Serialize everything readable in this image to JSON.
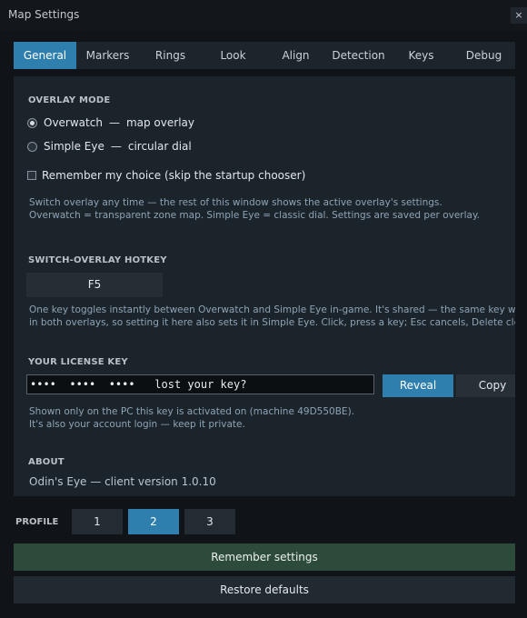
{
  "window": {
    "title": "Map Settings",
    "close_glyph": "×"
  },
  "tabs": [
    {
      "label": "General",
      "active": true
    },
    {
      "label": "Markers",
      "active": false
    },
    {
      "label": "Rings",
      "active": false
    },
    {
      "label": "Look",
      "active": false
    },
    {
      "label": "Align",
      "active": false
    },
    {
      "label": "Detection",
      "active": false
    },
    {
      "label": "Keys",
      "active": false
    },
    {
      "label": "Debug",
      "active": false
    }
  ],
  "overlay_mode": {
    "heading": "OVERLAY MODE",
    "options": [
      {
        "name": "Overwatch",
        "desc": "map overlay",
        "selected": true
      },
      {
        "name": "Simple Eye",
        "desc": "circular dial",
        "selected": false
      }
    ],
    "separator": "—",
    "remember": {
      "label": "Remember my choice (skip the startup chooser)",
      "checked": false
    },
    "note_lines": [
      "Switch overlay any time — the rest of this window shows the active overlay's settings.",
      "Overwatch = transparent zone map. Simple Eye = classic dial. Settings are saved per overlay."
    ]
  },
  "hotkey": {
    "heading": "SWITCH-OVERLAY HOTKEY",
    "value": "F5",
    "note_lines": [
      "One key toggles instantly between Overwatch and Simple Eye in-game. It's shared — the same key works",
      "in both overlays, so setting it here also sets it in Simple Eye. Click, press a key; Esc cancels, Delete clears."
    ]
  },
  "license": {
    "heading": "YOUR LICENSE KEY",
    "field_value": "••••  ••••  ••••   lost your key?",
    "reveal_label": "Reveal",
    "copy_label": "Copy",
    "note_lines": [
      "Shown only on the PC this key is activated on (machine 49D550BE).",
      "It's also your account login — keep it private."
    ]
  },
  "about": {
    "heading": "ABOUT",
    "text": "Odin's Eye — client version 1.0.10"
  },
  "profile": {
    "label": "PROFILE",
    "options": [
      {
        "label": "1",
        "active": false
      },
      {
        "label": "2",
        "active": true
      },
      {
        "label": "3",
        "active": false
      }
    ]
  },
  "actions": {
    "remember_label": "Remember settings",
    "restore_label": "Restore defaults"
  },
  "colors": {
    "accent": "#2e7fae",
    "window_bg": "#101317",
    "panel_bg": "#1c242b",
    "remember_bg": "#2c4b3a",
    "note_text": "#8ea3b5"
  }
}
